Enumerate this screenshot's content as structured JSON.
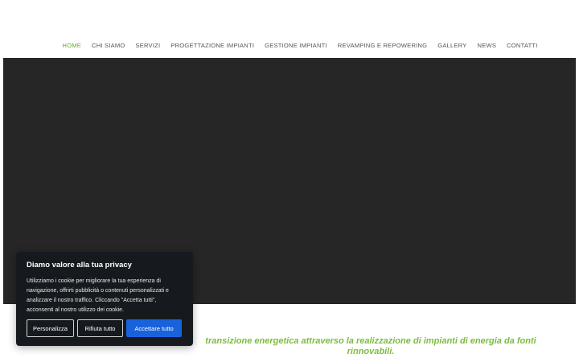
{
  "nav": {
    "items": [
      {
        "label": "HOME",
        "active": true
      },
      {
        "label": "CHI SIAMO",
        "active": false
      },
      {
        "label": "SERVIZI",
        "active": false
      },
      {
        "label": "PROGETTAZIONE IMPIANTI",
        "active": false
      },
      {
        "label": "GESTIONE IMPIANTI",
        "active": false
      },
      {
        "label": "REVAMPING E REPOWERING",
        "active": false
      },
      {
        "label": "GALLERY",
        "active": false
      },
      {
        "label": "NEWS",
        "active": false
      },
      {
        "label": "CONTATTI",
        "active": false
      }
    ]
  },
  "hero": {
    "background_color": "#262626"
  },
  "tagline": {
    "line1": "transizione energetica attraverso la realizzazione di impianti di energia da fonti",
    "line2": "rinnovabili.",
    "color": "#7bbd3f"
  },
  "cookie_banner": {
    "title": "Diamo valore alla tua privacy",
    "text": "Utilizziamo i cookie per migliorare la tua esperienza di navigazione, offrirti pubblicità o contenuti personalizzati e analizzare il nostro traffico. Cliccando \"Accetta tutti\", acconsenti al nostro utilizzo dei cookie.",
    "buttons": {
      "customize": "Personalizza",
      "reject": "Rifiuta tutto",
      "accept": "Accettare tutto"
    },
    "accept_color": "#1863dc"
  },
  "colors": {
    "nav_active": "#6aa834",
    "nav_default": "#555555"
  }
}
